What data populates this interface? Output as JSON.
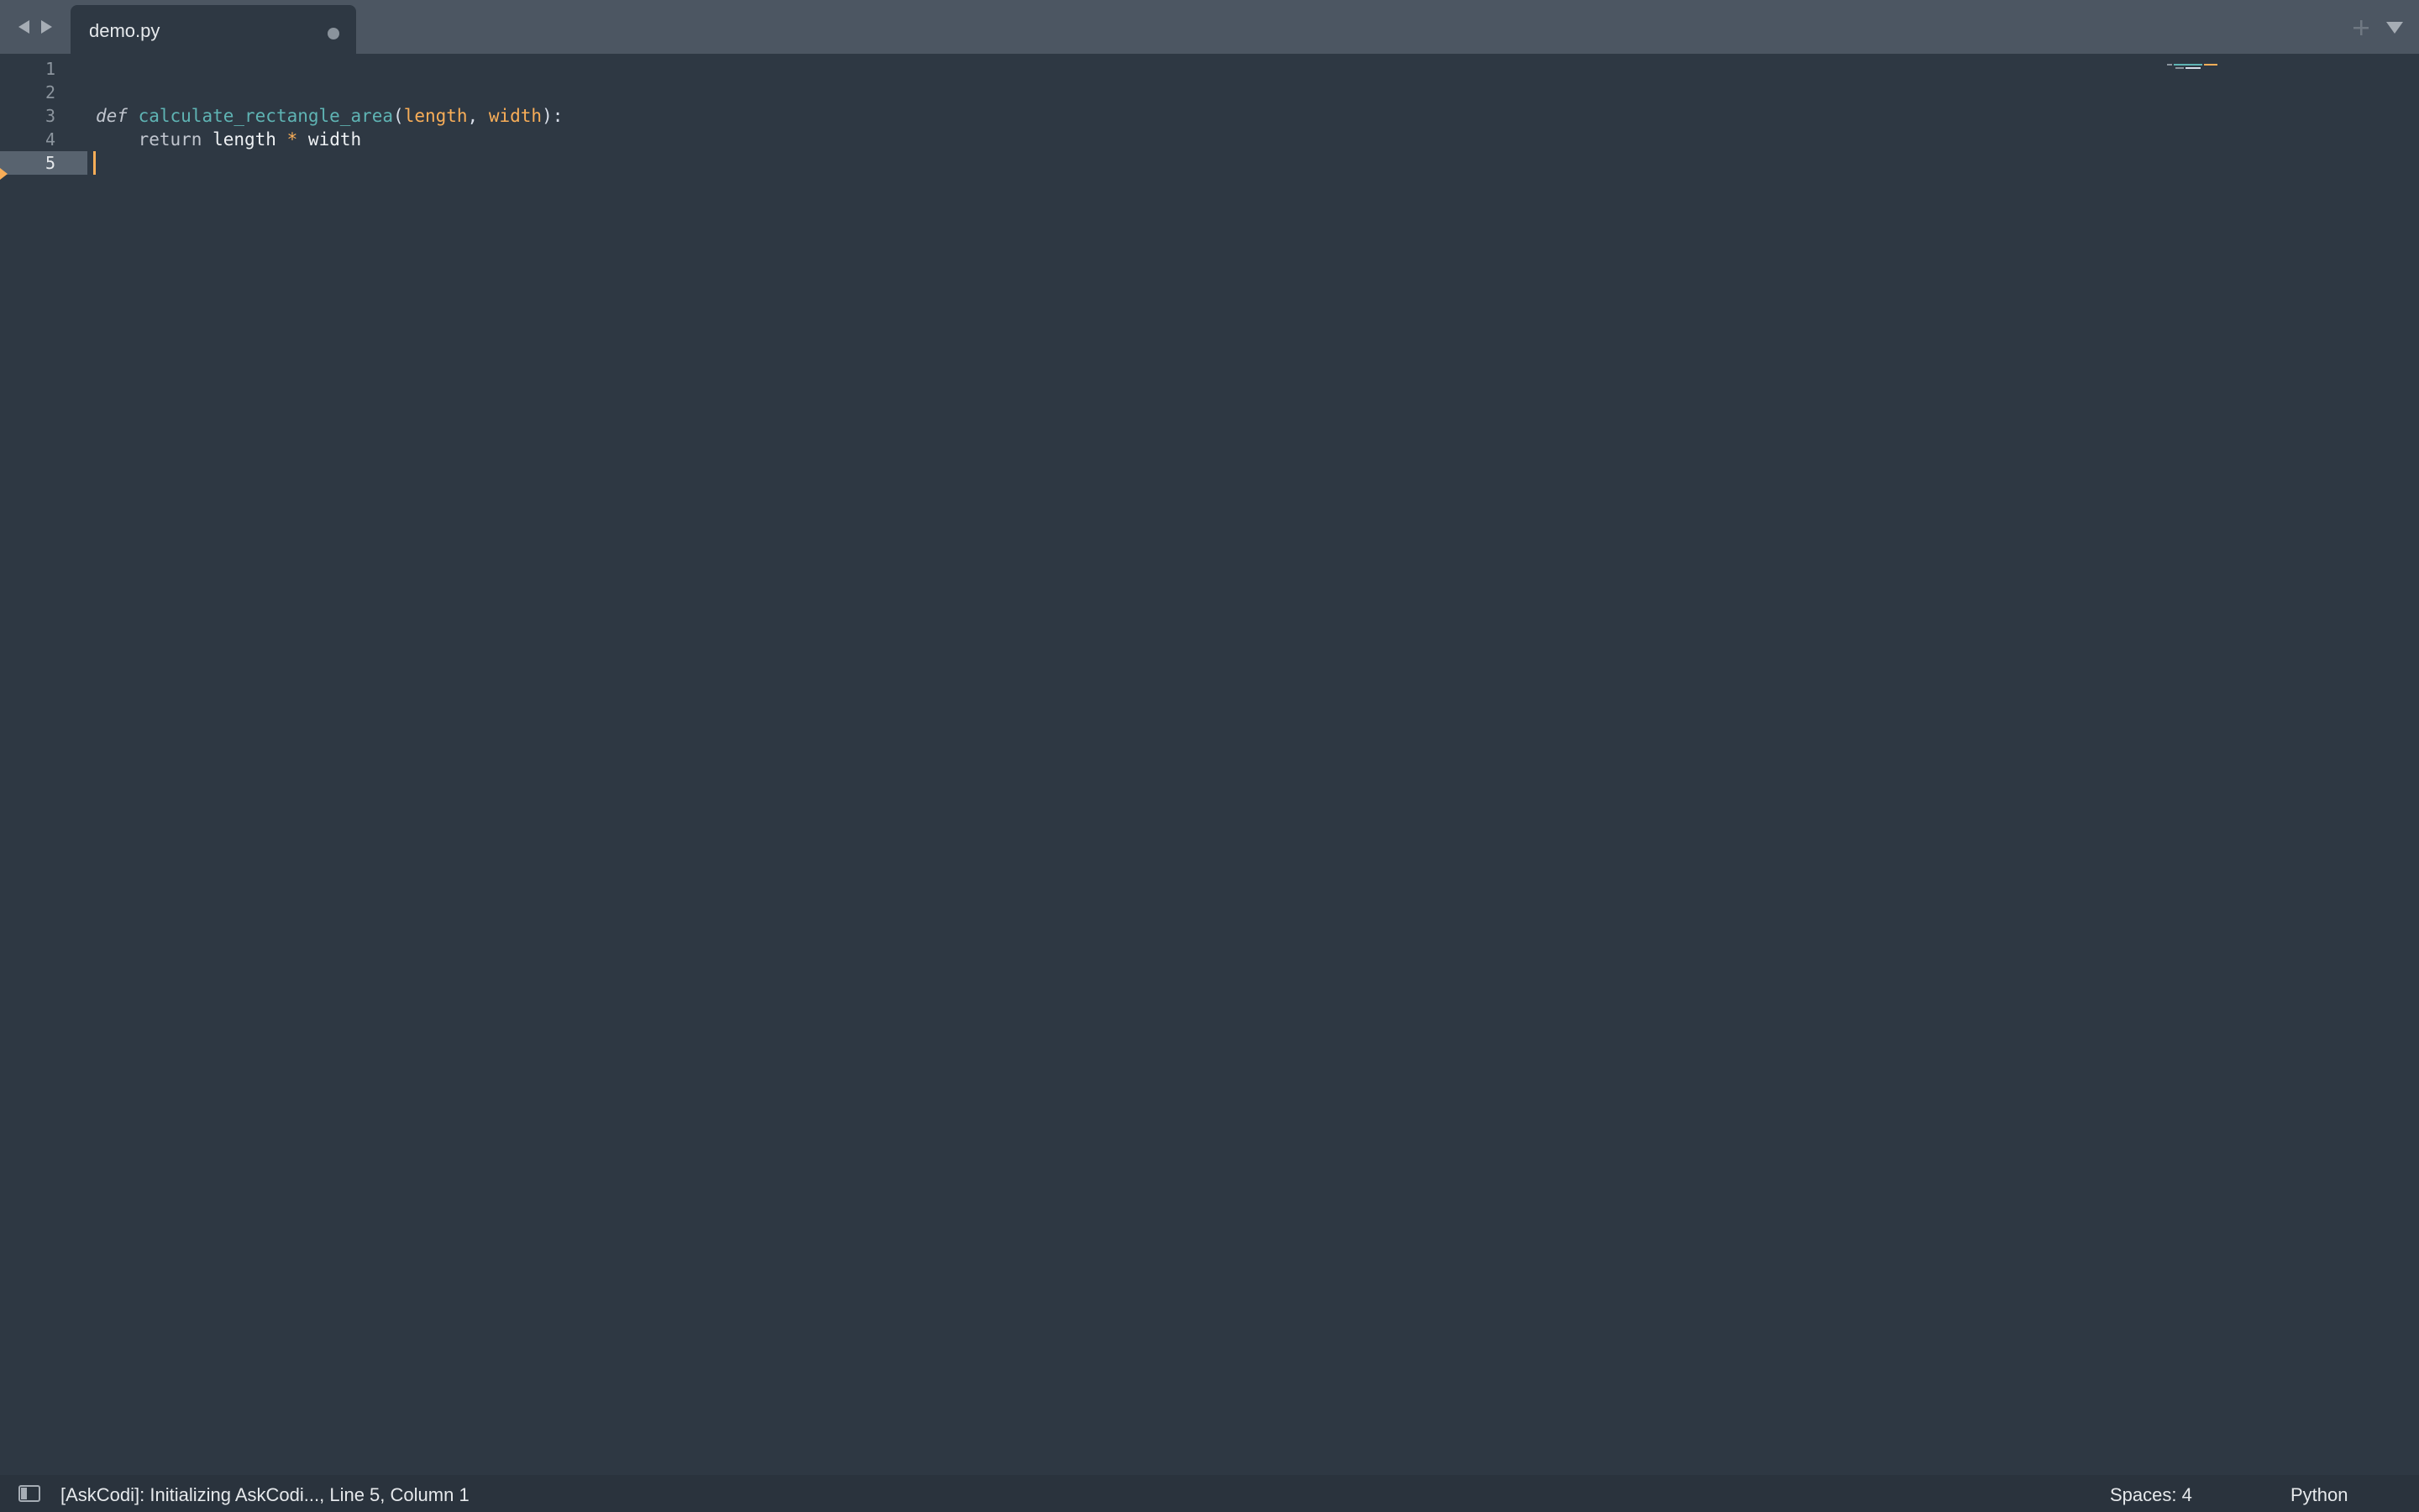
{
  "tabs": [
    {
      "title": "demo.py",
      "modified": true,
      "active": true
    }
  ],
  "editor": {
    "line_numbers": [
      "1",
      "2",
      "3",
      "4",
      "5"
    ],
    "active_line": "5",
    "code": {
      "line3": {
        "kw_def": "def",
        "fn_name": "calculate_rectangle_area",
        "open_paren": "(",
        "param1": "length",
        "comma": ",",
        "param2": "width",
        "close": "):"
      },
      "line4": {
        "indent": "    ",
        "kw_return": "return",
        "left": "length",
        "op": "*",
        "right": "width"
      }
    }
  },
  "statusbar": {
    "status_text": "[AskCodi]: Initializing AskCodi..., Line 5, Column 1",
    "indentation": "Spaces: 4",
    "syntax": "Python"
  },
  "icons": {
    "back": "chevron-left-icon",
    "forward": "chevron-right-icon",
    "new_tab": "plus-icon",
    "tab_menu": "triangle-down-icon",
    "sidebar_toggle": "sidebar-toggle-icon"
  },
  "colors": {
    "background": "#2e3843",
    "tabbar": "#4c5662",
    "statusbar": "#2a333d",
    "function": "#5fb4b4",
    "parameter": "#f9ae58",
    "caret": "#f9ae58"
  }
}
